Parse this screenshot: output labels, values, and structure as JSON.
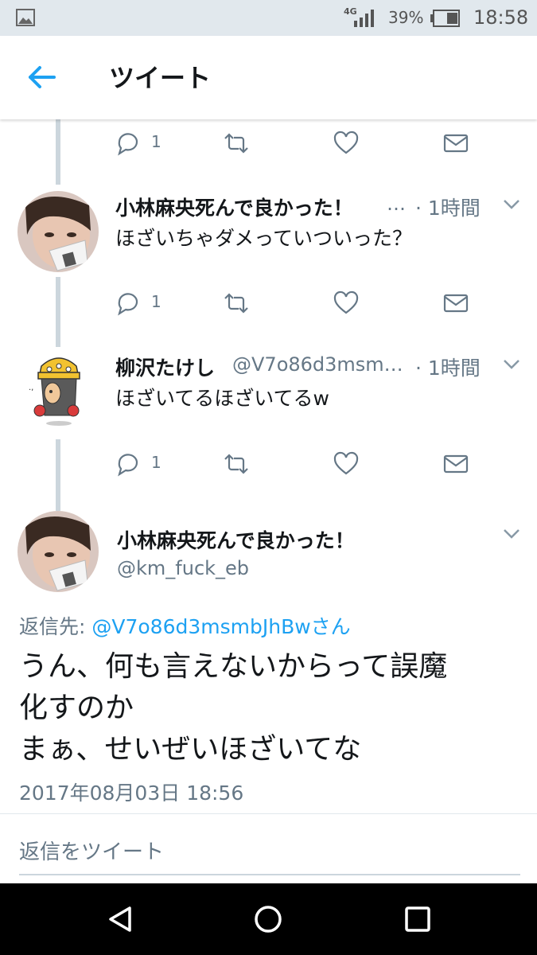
{
  "status_bar": {
    "network": "4G",
    "battery_percent": "39%",
    "time": "18:58"
  },
  "header": {
    "title": "ツイート"
  },
  "tweets": [
    {
      "name": "小林麻央死んで良かった！",
      "handle": "…",
      "time": "· 1時間",
      "text": "ほざいちゃダメっていついった？",
      "reply_count": "1"
    },
    {
      "name": "柳沢たけし",
      "handle": "@V7o86d3msm…",
      "time": "· 1時間",
      "text": "ほざいてるほざいてるw",
      "reply_count": "1"
    }
  ],
  "top_action_row": {
    "reply_count": "1"
  },
  "focused_tweet": {
    "name": "小林麻央死んで良かった！",
    "handle": "@km_fuck_eb",
    "reply_label": "返信先: ",
    "reply_target": "@V7o86d3msmbJhBwさん",
    "text_lines": [
      "うん、何も言えないからって誤魔",
      "化すのか",
      "まぁ、せいぜいほざいてな"
    ],
    "timestamp": "2017年08月03日 18:56",
    "reply_placeholder": "返信をツイート"
  },
  "colors": {
    "accent": "#1da1f2",
    "secondary_text": "#657786",
    "thread_line": "#ccd6dd"
  }
}
